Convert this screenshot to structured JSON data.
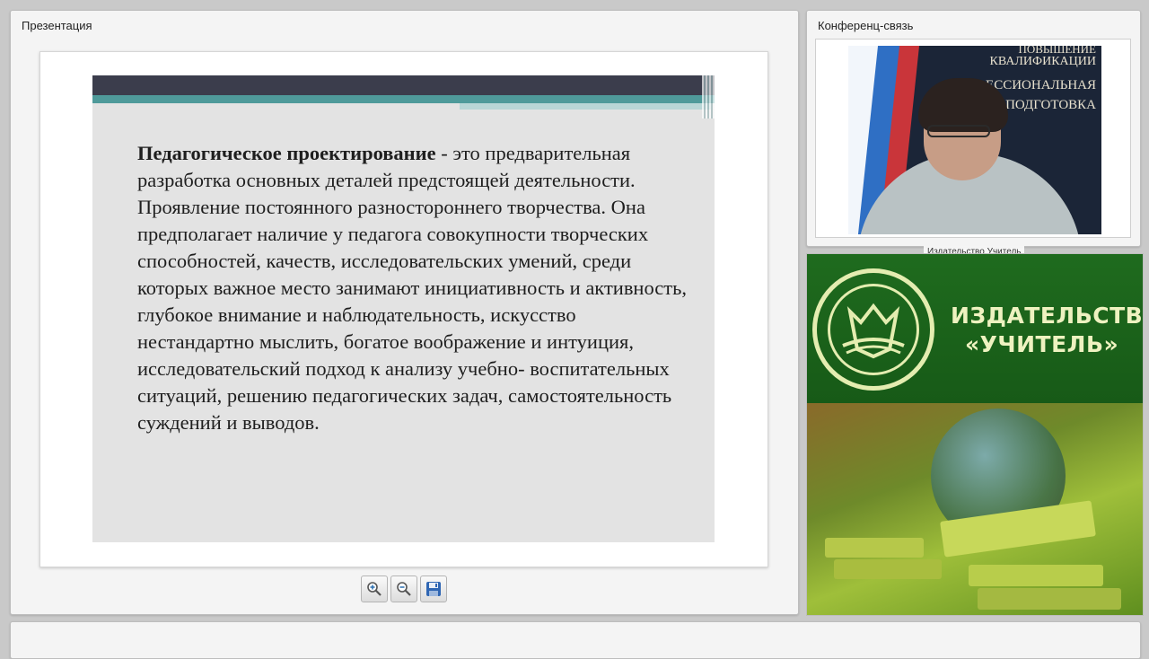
{
  "presentation": {
    "title": "Презентация",
    "slide": {
      "term": "Педагогическое проектирование",
      "text": " - это предварительная разработка основных деталей предстоящей деятельности. Проявление постоянного разностороннего творчества. Она предполагает наличие у педагога совокупности творческих способностей, качеств, исследовательских умений, среди которых важное место занимают инициативность и активность, глубокое внимание и наблюдательность, искусство нестандартно мыслить, богатое воображение и интуиция, исследовательский подход к анализу учебно- воспитательных ситуаций, решению педагогических задач, самостоятельность суждений и выводов."
    },
    "toolbar": {
      "zoom_in_icon": "zoom-in-icon",
      "zoom_out_icon": "zoom-out-icon",
      "save_icon": "save-icon"
    }
  },
  "conference": {
    "title": "Конференц-связь",
    "video_caption": "Издательство Учитель",
    "poster_lines": [
      "ПОВЫШЕНИЕ",
      "КВАЛИФИКАЦИИ",
      "ЕССИОНАЛЬНАЯ",
      "ПОДГОТОВКА"
    ]
  },
  "banner": {
    "line1": "ИЗДАТЕЛЬСТВО",
    "line2": "«УЧИТЕЛЬ»"
  },
  "colors": {
    "banner_green": "#1f6b1e",
    "slide_bar_dark": "#3b3d4c",
    "slide_bar_teal": "#4f9a9a"
  }
}
